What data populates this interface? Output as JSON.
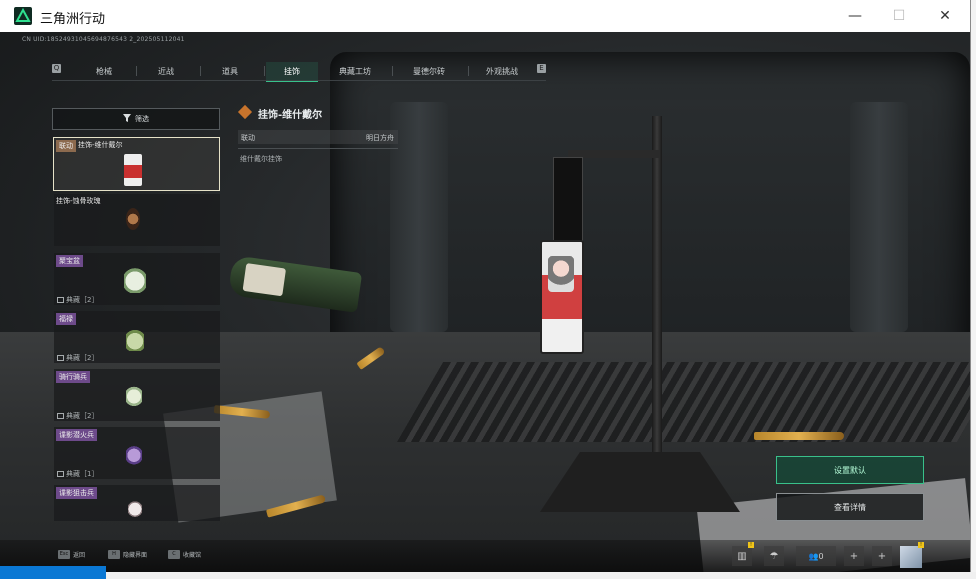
{
  "window": {
    "title": "三角洲行动",
    "controls": {
      "minimize": "—",
      "maximize": "☐",
      "close": "✕"
    }
  },
  "uid_text": "CN UID:18524931045694876543 2_202505112041",
  "tabs": [
    {
      "label": "枪械"
    },
    {
      "label": "近战"
    },
    {
      "label": "道具"
    },
    {
      "label": "挂饰",
      "active": true
    },
    {
      "label": "典藏工坊"
    },
    {
      "label": "曼德尔砖"
    },
    {
      "label": "外观挑战"
    }
  ],
  "tab_edges": {
    "left": "Q",
    "right": "E"
  },
  "filter": {
    "label": "筛选",
    "icon": "filter-icon"
  },
  "items": [
    {
      "tag": "联动",
      "name": "挂饰-维什戴尔",
      "foot": "",
      "selected": true,
      "tag_color": "#8c6a4e",
      "thumb": "#c9302f"
    },
    {
      "tag": "",
      "name": "挂饰-蚀骨玫瑰",
      "foot": "",
      "tag_color": "",
      "thumb": "#5a3a2a"
    },
    {
      "tag": "",
      "name": "聚宝盆",
      "foot": "典藏［2］",
      "tag_color": "#6d4a8a",
      "thumb": "#d6e3c8"
    },
    {
      "tag": "",
      "name": "福禄",
      "foot": "典藏［2］",
      "tag_color": "#6d4a8a",
      "thumb": "#8fae7a"
    },
    {
      "tag": "",
      "name": "骑行骑兵",
      "foot": "典藏［2］",
      "tag_color": "#6d4a8a",
      "thumb": "#cfe0c0"
    },
    {
      "tag": "",
      "name": "谍影潜火兵",
      "foot": "典藏［1］",
      "tag_color": "#6d4a8a",
      "thumb": "#8a6fb0"
    },
    {
      "tag": "",
      "name": "谍影狙击兵",
      "foot": "",
      "tag_color": "#6d4a8a",
      "thumb": "#d9d2d4"
    }
  ],
  "detail": {
    "title": "挂饰-维什戴尔",
    "row_key": "联动",
    "row_value": "明日方舟",
    "desc": "维什戴尔挂饰"
  },
  "actions": {
    "set_default": "设置默认",
    "view_detail": "查看详情"
  },
  "bottom_hints": [
    {
      "key": "Esc",
      "label": "返回"
    },
    {
      "key": "H",
      "label": "隐藏界面"
    },
    {
      "key": "C",
      "label": "收藏馆"
    }
  ],
  "utility": {
    "squad_count": "0"
  },
  "colors": {
    "accent": "#38c28c",
    "highlight": "#e6e2c8"
  }
}
